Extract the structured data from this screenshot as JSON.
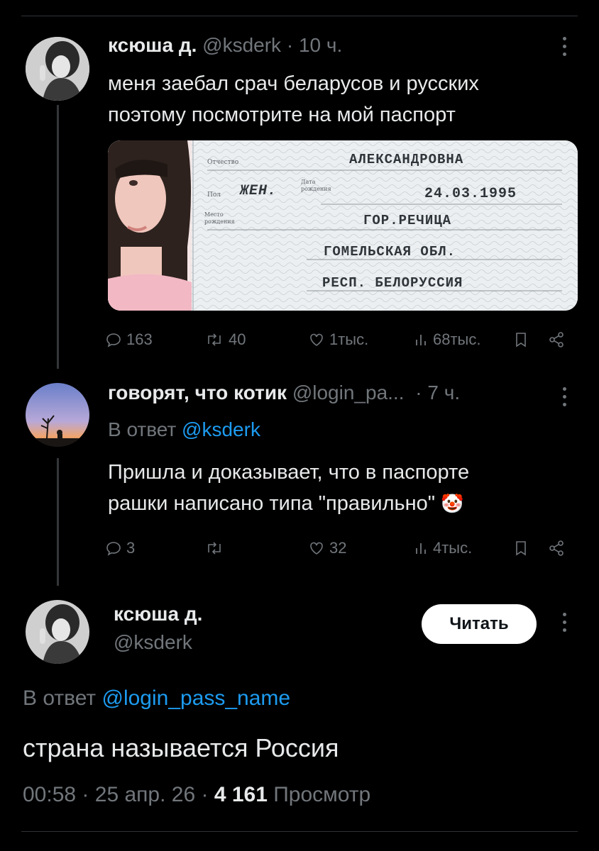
{
  "tweet1": {
    "name": "ксюша д.",
    "handle": "@ksderk",
    "sep": "·",
    "time": "10 ч.",
    "text_line1": "меня заебал срач беларусов и русских",
    "text_line2": "поэтому посмотрите на мой паспорт",
    "passport": {
      "label_patronymic": "Отчество",
      "label_sex": "Пол",
      "label_dob": "Дата рождения",
      "label_place": "Место рождения",
      "patronymic": "АЛЕКСАНДРОВНА",
      "sex": "ЖЕН.",
      "dob": "24.03.1995",
      "city": "ГОР.РЕЧИЦА",
      "region": "ГОМЕЛЬСКАЯ ОБЛ.",
      "country": "РЕСП. БЕЛОРУССИЯ"
    },
    "replies": "163",
    "retweets": "40",
    "likes": "1тыс.",
    "views": "68тыс."
  },
  "tweet2": {
    "name": "говорят, что котик",
    "handle": "@login_pa...",
    "sep": "·",
    "time": "7 ч.",
    "reply_prefix": "В ответ",
    "reply_to": "@ksderk",
    "text_line1": "Пришла и доказывает, что в паспорте",
    "text_line2": "рашки написано типа \"правильно\"",
    "emoji": "🤡",
    "replies": "3",
    "retweets": "",
    "likes": "32",
    "views": "4тыс."
  },
  "tweet3": {
    "name": "ксюша д.",
    "handle": "@ksderk",
    "follow_label": "Читать",
    "reply_prefix": "В ответ",
    "reply_to": "@login_pass_name",
    "text": "страна называется Россия",
    "time": "00:58",
    "sep": "·",
    "date": "25 апр. 26",
    "views_count": "4 161",
    "views_label": "Просмотр"
  },
  "colors": {
    "accent": "#1d9bf0",
    "muted": "#71767b",
    "text": "#e7e9ea",
    "bg": "#000000"
  }
}
